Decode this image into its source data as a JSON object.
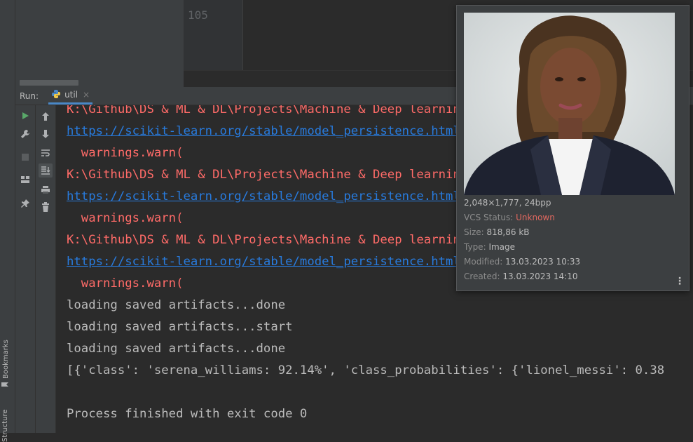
{
  "editor": {
    "line_number": "105"
  },
  "side_tabs": {
    "bookmarks": "Bookmarks",
    "structure": "Structure"
  },
  "run_panel": {
    "label": "Run:",
    "tab_name": "util",
    "tab_close": "×"
  },
  "console": {
    "lines": [
      "K:\\Github\\DS & ML & DL\\Projects\\Machine & Deep learning",
      "https://scikit-learn.org/stable/model_persistence.html",
      "  warnings.warn(",
      "K:\\Github\\DS & ML & DL\\Projects\\Machine & Deep learning",
      "https://scikit-learn.org/stable/model_persistence.html",
      "  warnings.warn(",
      "K:\\Github\\DS & ML & DL\\Projects\\Machine & Deep learning",
      "https://scikit-learn.org/stable/model_persistence.html",
      "  warnings.warn(",
      "loading saved artifacts...done",
      "loading saved artifacts...start",
      "loading saved artifacts...done",
      "[{'class': 'serena_williams: 92.14%', 'class_probabilities': {'lionel_messi': 0.38",
      "",
      "Process finished with exit code 0"
    ]
  },
  "image_popup": {
    "dimensions": "2,048×1,777, 24bpp",
    "vcs_status_label": "VCS Status:",
    "vcs_status_value": "Unknown",
    "size_label": "Size:",
    "size_value": "818,86 kB",
    "type_label": "Type:",
    "type_value": "Image",
    "modified_label": "Modified:",
    "modified_value": "13.03.2023 10:33",
    "created_label": "Created:",
    "created_value": "13.03.2023 14:10",
    "menu_icon": "more-vertical-icon"
  },
  "colors": {
    "error_text": "#ff6b68",
    "link_text": "#287bde",
    "normal_text": "#bbbbbb",
    "vcs_unknown": "#e0685f",
    "run_icon": "#59a869"
  }
}
